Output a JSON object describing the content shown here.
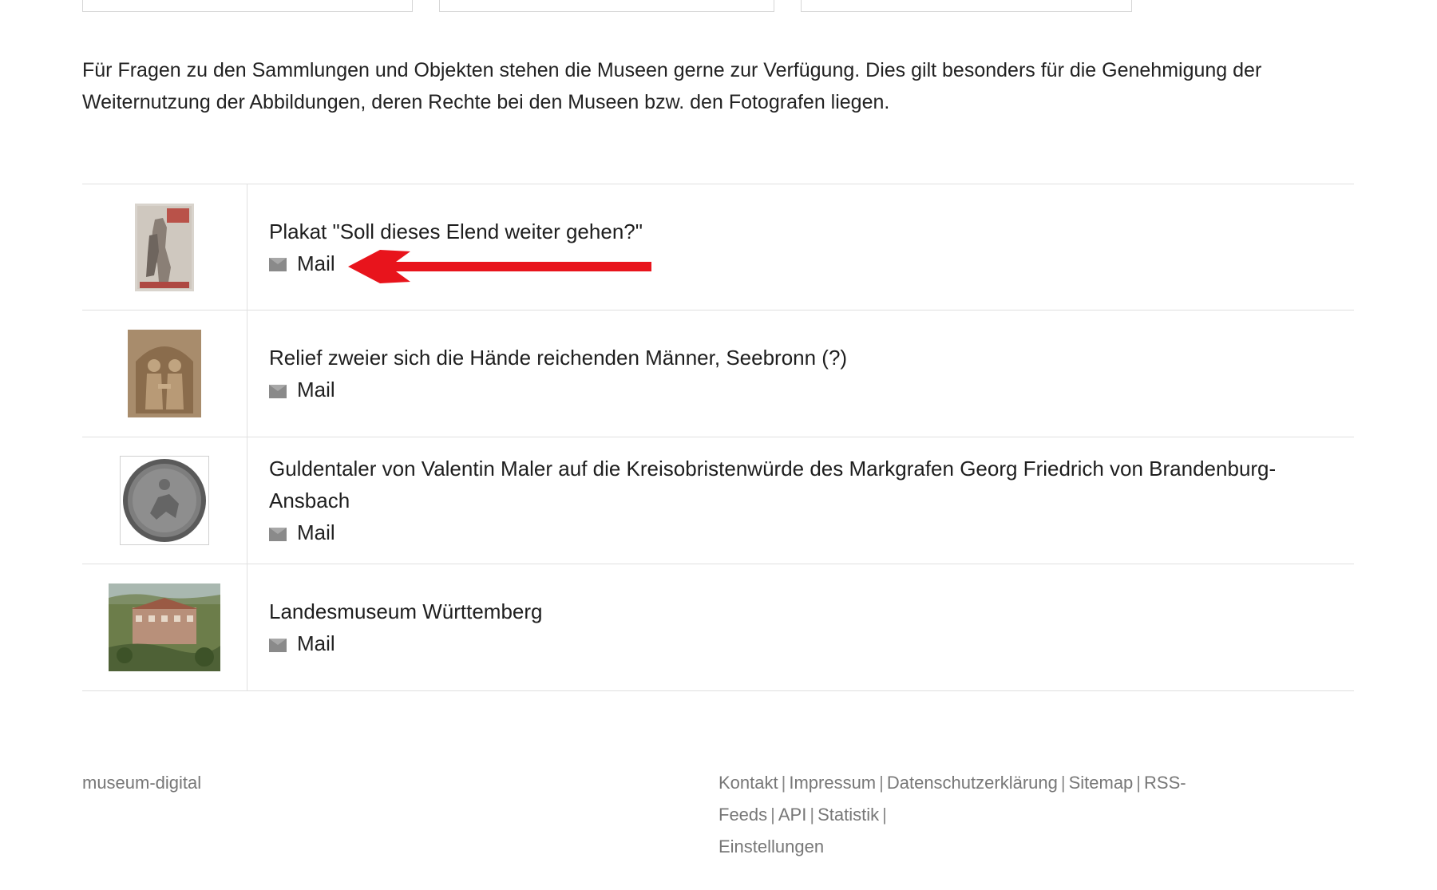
{
  "intro_text": "Für Fragen zu den Sammlungen und Objekten stehen die Museen gerne zur Verfügung. Dies gilt besonders für die Genehmigung der Weiternutzung der Abbildungen, deren Rechte bei den Museen bzw. den Fotografen liegen.",
  "contacts": [
    {
      "title": "Plakat \"Soll dieses Elend weiter gehen?\"",
      "mail_label": "Mail"
    },
    {
      "title": "Relief zweier sich die Hände reichenden Männer, Seebronn (?)",
      "mail_label": "Mail"
    },
    {
      "title": "Guldentaler von Valentin Maler auf die Kreisobristenwürde des Markgrafen Georg Friedrich von Brandenburg-Ansbach",
      "mail_label": "Mail"
    },
    {
      "title": "Landesmuseum Württemberg",
      "mail_label": "Mail"
    }
  ],
  "footer": {
    "site_name": "museum-digital",
    "links": [
      "Kontakt",
      "Impressum",
      "Datenschutzerklärung",
      "Sitemap",
      "RSS-Feeds",
      "API",
      "Statistik",
      "Einstellungen"
    ],
    "separator": "|"
  },
  "annotation": {
    "arrow_color": "#e8141c"
  },
  "icons": {
    "mail": "envelope-icon"
  }
}
